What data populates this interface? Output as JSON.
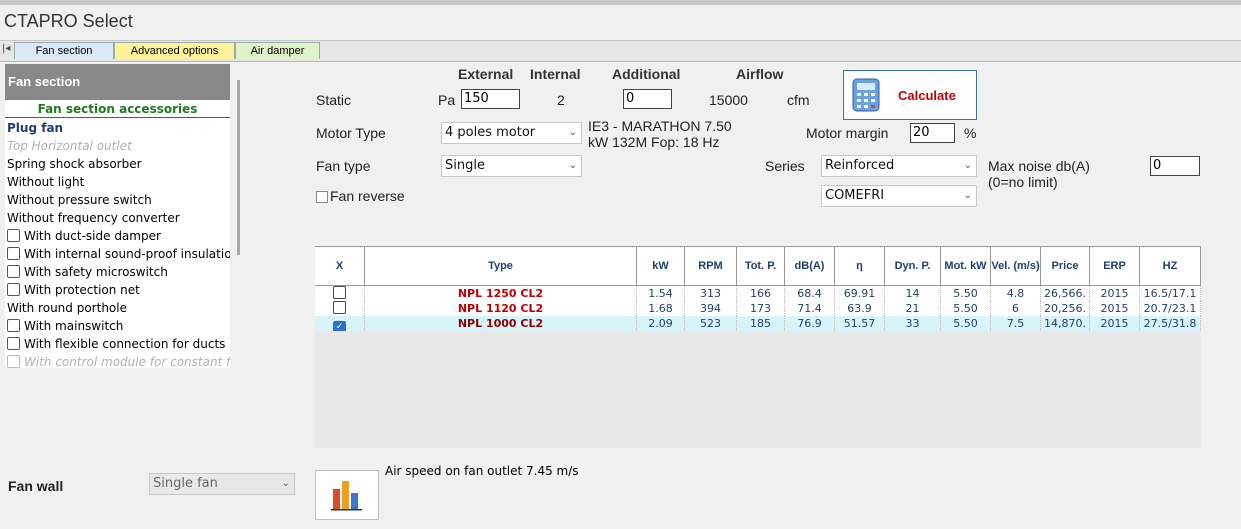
{
  "window": {
    "title": "CTAPRO Select"
  },
  "tabs": [
    {
      "label": "Fan section",
      "color": "#dbe9f7"
    },
    {
      "label": "Advanced options",
      "color": "#fff39a"
    },
    {
      "label": "Air damper",
      "color": "#dff2c8"
    }
  ],
  "left_panel": {
    "header": "Fan section",
    "subheader": "Fan section accessories",
    "items": [
      {
        "label": "Plug fan",
        "checkbox": false,
        "style": "selected"
      },
      {
        "label": "Top Horizontal outlet",
        "checkbox": false,
        "style": "disabled"
      },
      {
        "label": "Spring shock absorber",
        "checkbox": false,
        "style": "normal"
      },
      {
        "label": "Without light",
        "checkbox": false,
        "style": "normal"
      },
      {
        "label": "Without pressure switch",
        "checkbox": false,
        "style": "normal"
      },
      {
        "label": "Without frequency converter",
        "checkbox": false,
        "style": "normal"
      },
      {
        "label": "With duct-side damper",
        "checkbox": true,
        "style": "normal"
      },
      {
        "label": "With internal sound-proof insulation",
        "checkbox": true,
        "style": "normal"
      },
      {
        "label": "With safety microswitch",
        "checkbox": true,
        "style": "normal"
      },
      {
        "label": "With protection net",
        "checkbox": true,
        "style": "normal"
      },
      {
        "label": "With round porthole",
        "checkbox": false,
        "style": "normal"
      },
      {
        "label": "With mainswitch",
        "checkbox": true,
        "style": "normal"
      },
      {
        "label": "With flexible connection for ducts",
        "checkbox": true,
        "style": "normal"
      },
      {
        "label": "With control module for constant flo",
        "checkbox": true,
        "style": "disabled"
      }
    ]
  },
  "form": {
    "col_external": "External",
    "col_internal": "Internal",
    "col_additional": "Additional",
    "col_airflow": "Airflow",
    "static_label": "Static",
    "static_unit": "Pa",
    "external_value": "150",
    "internal_value": "2",
    "additional_value": "0",
    "airflow_value": "15000",
    "airflow_unit": "cfm",
    "calculate_label": "Calculate",
    "motor_type_label": "Motor Type",
    "motor_type_value": "4 poles motor",
    "motor_info_line1": "IE3 - MARATHON 7.50",
    "motor_info_line2": "kW 132M  Fop: 18 Hz",
    "motor_margin_label": "Motor margin",
    "motor_margin_value": "20",
    "motor_margin_unit": "%",
    "fan_type_label": "Fan type",
    "fan_type_value": "Single",
    "series_label": "Series",
    "series_value": "Reinforced",
    "manufacturer_value": "COMEFRI",
    "max_noise_label": "Max noise db(A)",
    "max_noise_note": "(0=no limit)",
    "max_noise_value": "0",
    "fan_reverse_label": "Fan reverse"
  },
  "table": {
    "columns": [
      "X",
      "Type",
      "kW",
      "RPM",
      "Tot. P.",
      "dB(A)",
      "η",
      "Dyn. P.",
      "Mot. kW",
      "Vel. (m/s)",
      "Price",
      "ERP",
      "HZ"
    ],
    "rows": [
      {
        "checked": false,
        "type": "NPL 1250 CL2",
        "kw": "1.54",
        "rpm": "313",
        "tot_p": "166",
        "dba": "68.4",
        "eta": "69.91",
        "dyn_p": "14",
        "mot_kw": "5.50",
        "vel": "4.8",
        "price": "26,566.",
        "erp": "2015",
        "hz": "16.5/17.1"
      },
      {
        "checked": false,
        "type": "NPL 1120 CL2",
        "kw": "1.68",
        "rpm": "394",
        "tot_p": "173",
        "dba": "71.4",
        "eta": "63.9",
        "dyn_p": "21",
        "mot_kw": "5.50",
        "vel": "6",
        "price": "20,256.",
        "erp": "2015",
        "hz": "20.7/23.1"
      },
      {
        "checked": true,
        "type": "NPL 1000 CL2",
        "kw": "2.09",
        "rpm": "523",
        "tot_p": "185",
        "dba": "76.9",
        "eta": "51.57",
        "dyn_p": "33",
        "mot_kw": "5.50",
        "vel": "7.5",
        "price": "14,870.",
        "erp": "2015",
        "hz": "27.5/31.8"
      }
    ]
  },
  "footer": {
    "fan_wall_label": "Fan wall",
    "fan_wall_value": "Single fan",
    "air_speed_text": "Air speed on fan outlet  7.45 m/s"
  }
}
